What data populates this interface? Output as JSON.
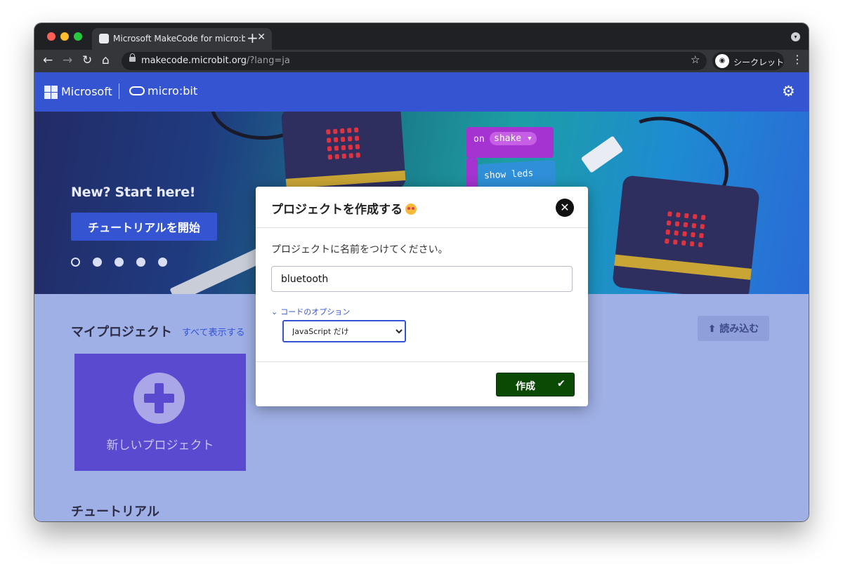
{
  "browser": {
    "tab_title": "Microsoft MakeCode for micro:bit",
    "tab_close": "✕",
    "new_tab": "+",
    "url_host": "makecode.microbit.org",
    "url_path": "/?lang=ja",
    "profile_label": "シークレット",
    "nav_back": "←",
    "nav_forward": "→",
    "nav_reload": "↻",
    "nav_home": "⌂",
    "star": "☆",
    "menu": "⋮"
  },
  "header": {
    "ms_name": "Microsoft",
    "microbit_name": "micro:bit",
    "settings_icon": "⚙"
  },
  "hero": {
    "title": "New? Start here!",
    "button_label": "チュートリアルを開始",
    "dots": 5,
    "block_on": "on",
    "block_shake": "shake ▾",
    "block_show_leds": "show leds"
  },
  "content": {
    "my_projects": "マイプロジェクト",
    "show_all": "すべて表示する",
    "import_label": "読み込む",
    "new_project": "新しいプロジェクト",
    "tutorials": "チュートリアル"
  },
  "modal": {
    "title": "プロジェクトを作成する",
    "close_icon": "✕",
    "prompt": "プロジェクトに名前をつけてください。",
    "name_value": "bluetooth",
    "code_options": "コードのオプション",
    "language_selected": "JavaScript だけ",
    "create_label": "作成",
    "create_icon": "✔"
  },
  "colors": {
    "header_blue": "#3454d1",
    "content_bg": "#9fb0e6",
    "new_project_card": "#5a4ad0",
    "create_button": "#0a4a05"
  }
}
